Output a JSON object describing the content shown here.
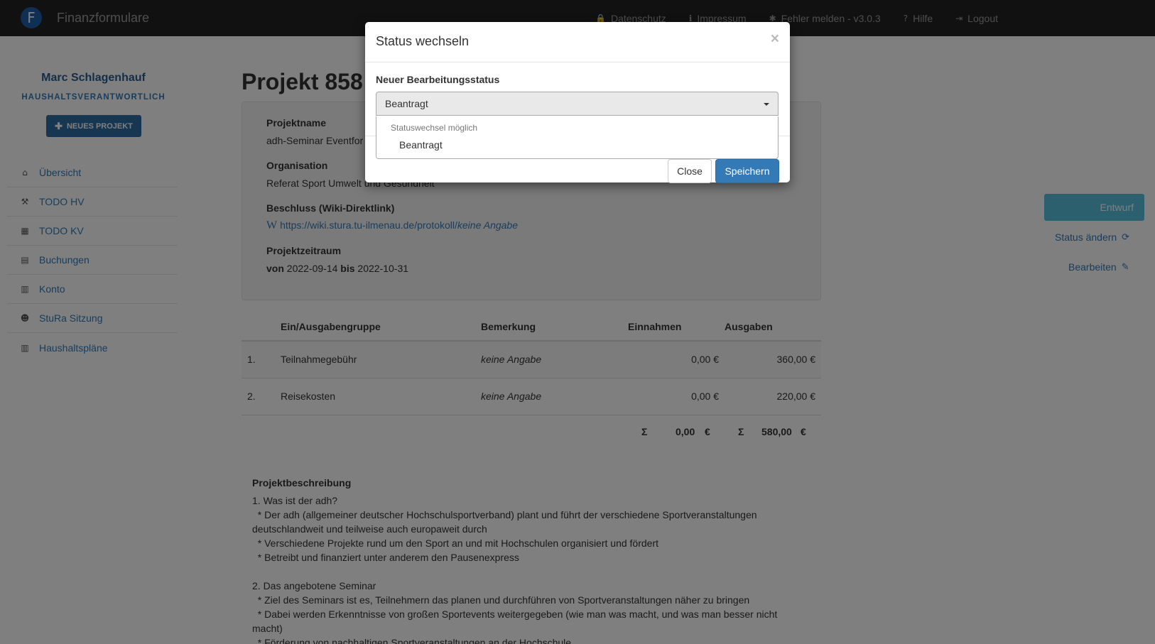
{
  "navbar": {
    "brand_letter": "F",
    "brand_name": "Finanzformulare",
    "links": [
      {
        "icon": "lock-icon",
        "glyph": "🔒",
        "label": "Datenschutz"
      },
      {
        "icon": "info-icon",
        "glyph": "ℹ",
        "label": "Impressum"
      },
      {
        "icon": "bug-icon",
        "glyph": "✱",
        "label": "Fehler melden - v3.0.3"
      },
      {
        "icon": "question-icon",
        "glyph": "?",
        "label": "Hilfe"
      },
      {
        "icon": "logout-icon",
        "glyph": "⇥",
        "label": "Logout"
      }
    ]
  },
  "sidebar": {
    "user_name": "Marc Schlagenhauf",
    "user_role": "HAUSHALTSVERANTWORTLICH",
    "new_project_label": "NEUES PROJEKT",
    "items": [
      {
        "icon": "home-icon",
        "glyph": "⌂",
        "label": "Übersicht"
      },
      {
        "icon": "gavel-icon",
        "glyph": "⚒",
        "label": "TODO HV"
      },
      {
        "icon": "calculator-icon",
        "glyph": "▦",
        "label": "TODO KV"
      },
      {
        "icon": "book-icon",
        "glyph": "▤",
        "label": "Buchungen"
      },
      {
        "icon": "bar-chart-icon",
        "glyph": "▥",
        "label": "Konto"
      },
      {
        "icon": "users-icon",
        "glyph": "☻",
        "label": "StuRa Sitzung"
      },
      {
        "icon": "bar-chart-icon",
        "glyph": "▥",
        "label": "Haushaltspläne"
      }
    ]
  },
  "project": {
    "title": "Projekt 858",
    "name_label": "Projektname",
    "name_value": "adh-Seminar Eventfor",
    "org_label": "Organisation",
    "org_value": "Referat Sport Umwelt und Gesundheit",
    "decision_label": "Beschluss (Wiki-Direktlink)",
    "decision_link": "https://wiki.stura.tu-ilmenau.de/protokoll/",
    "decision_link_suffix": "keine Angabe",
    "period_label": "Projektzeitraum",
    "period_from_word": "von",
    "period_from": "2022-09-14",
    "period_to_word": "bis",
    "period_to": "2022-10-31"
  },
  "budget": {
    "headers": [
      "Ein/Ausgabengruppe",
      "Bemerkung",
      "Einnahmen",
      "Ausgaben"
    ],
    "rows": [
      {
        "index": "1.",
        "group": "Teilnahmegebühr",
        "note": "keine Angabe",
        "income": "0,00 €",
        "expense": "360,00 €"
      },
      {
        "index": "2.",
        "group": "Reisekosten",
        "note": "keine Angabe",
        "income": "0,00 €",
        "expense": "220,00 €"
      }
    ],
    "sum_symbol": "Σ",
    "sum_income": "0,00",
    "sum_expense": "580,00",
    "currency": "€"
  },
  "description": {
    "title": "Projektbeschreibung",
    "body": "1. Was ist der adh?\n  * Der adh (allgemeiner deutscher Hochschulsportverband) plant und führt der verschiedene Sportveranstaltungen\ndeutschlandweit und teilweise auch europaweit durch\n  * Verschiedene Projekte rund um den Sport an und mit Hochschulen organisiert und fördert\n  * Betreibt und finanziert unter anderem den Pausenexpress\n\n2. Das angebotene Seminar\n  * Ziel des Seminars ist es, Teilnehmern das planen und durchführen von Sportveranstaltungen näher zu bringen\n  * Dabei werden Erkenntnisse von großen Sportevents weitergegeben (wie man was macht, und was man besser nicht\nmacht)\n  * Förderung von nachhaltigen Sportveranstaltungen an der Hochschule"
  },
  "status_panel": {
    "current_status": "Entwurf",
    "change_status_label": "Status ändern",
    "edit_label": "Bearbeiten"
  },
  "modal": {
    "title": "Status wechseln",
    "close_symbol": "×",
    "field_label": "Neuer Bearbeitungsstatus",
    "selected_value": "Beantragt",
    "dropdown_group": "Statuswechsel möglich",
    "dropdown_options": [
      "Beantragt"
    ],
    "close_button": "Close",
    "save_button": "Speichern"
  },
  "colors": {
    "navbar_bg": "#222222",
    "primary": "#337ab7",
    "info": "#5bc0de"
  }
}
